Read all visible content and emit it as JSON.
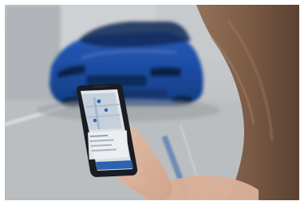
{
  "scene": {
    "subject": "hand-holding-smartphone-in-front-of-car",
    "accent_colors": {
      "car_blue": "#1f4fa8",
      "app_blue": "#2f66b8",
      "ground_gray": "#c9ccce",
      "hair_brown": "#7a5b45",
      "skin": "#e5c1aa"
    }
  }
}
